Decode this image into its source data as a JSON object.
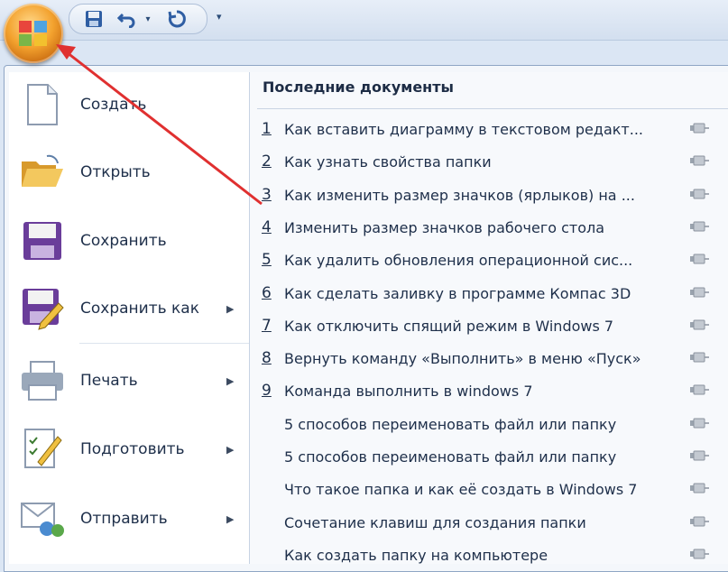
{
  "toolbar": {
    "office_button": "office-button",
    "save_icon": "save-icon",
    "undo_icon": "undo-icon",
    "redo_icon": "redo-icon",
    "customize_glyph": "▾"
  },
  "menu": {
    "commands": [
      {
        "label": "Создать",
        "icon": "new-document-icon",
        "submenu": false
      },
      {
        "label": "Открыть",
        "icon": "open-folder-icon",
        "submenu": false
      },
      {
        "label": "Сохранить",
        "icon": "save-icon",
        "submenu": false
      },
      {
        "label": "Сохранить как",
        "icon": "save-as-icon",
        "submenu": true
      },
      {
        "label": "Печать",
        "icon": "print-icon",
        "submenu": true
      },
      {
        "label": "Подготовить",
        "icon": "prepare-icon",
        "submenu": true
      },
      {
        "label": "Отправить",
        "icon": "send-icon",
        "submenu": true
      }
    ],
    "submenu_arrow": "▶"
  },
  "recent": {
    "title": "Последние документы",
    "items": [
      {
        "num": "1",
        "title": "Как вставить диаграмму в текстовом редакт..."
      },
      {
        "num": "2",
        "title": "Как узнать свойства папки"
      },
      {
        "num": "3",
        "title": "Как изменить размер значков (ярлыков) на ..."
      },
      {
        "num": "4",
        "title": "Изменить размер значков рабочего стола"
      },
      {
        "num": "5",
        "title": "Как удалить обновления операционной сис..."
      },
      {
        "num": "6",
        "title": "Как сделать заливку в программе Компас 3D"
      },
      {
        "num": "7",
        "title": "Как отключить спящий режим в Windows 7"
      },
      {
        "num": "8",
        "title": "Вернуть команду «Выполнить» в меню «Пуск»"
      },
      {
        "num": "9",
        "title": "Команда выполнить в windows 7"
      },
      {
        "num": "",
        "title": "5 способов переименовать файл или папку"
      },
      {
        "num": "",
        "title": "5 способов переименовать файл или папку"
      },
      {
        "num": "",
        "title": "Что такое папка и как её создать в Windows 7"
      },
      {
        "num": "",
        "title": "Сочетание клавиш для создания папки"
      },
      {
        "num": "",
        "title": "Как создать папку на компьютере"
      }
    ]
  },
  "colors": {
    "annotation_arrow": "#e03030",
    "office_orange": "#f3a22e"
  }
}
